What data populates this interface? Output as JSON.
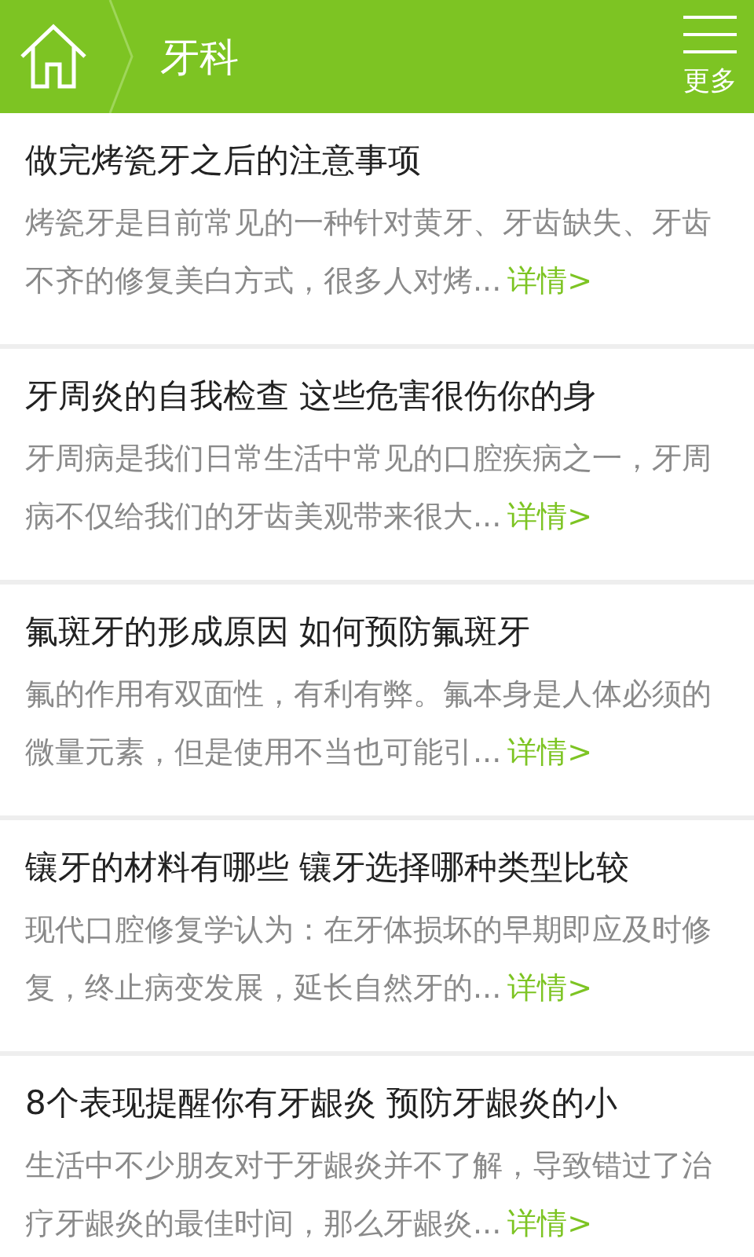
{
  "header": {
    "title": "牙科",
    "more_label": "更多"
  },
  "articles": [
    {
      "title": "做完烤瓷牙之后的注意事项",
      "excerpt": "烤瓷牙是目前常见的一种针对黄牙、牙齿缺失、牙齿不齐的修复美白方式，很多人对烤...",
      "link": "详情>"
    },
    {
      "title": "牙周炎的自我检查 这些危害很伤你的身",
      "excerpt": "牙周病是我们日常生活中常见的口腔疾病之一，牙周病不仅给我们的牙齿美观带来很大...",
      "link": "详情>"
    },
    {
      "title": "氟斑牙的形成原因 如何预防氟斑牙",
      "excerpt": "氟的作用有双面性，有利有弊。氟本身是人体必须的微量元素，但是使用不当也可能引...",
      "link": "详情>"
    },
    {
      "title": "镶牙的材料有哪些 镶牙选择哪种类型比较",
      "excerpt": "现代口腔修复学认为：在牙体损坏的早期即应及时修复，终止病变发展，延长自然牙的...",
      "link": "详情>"
    },
    {
      "title": "8个表现提醒你有牙龈炎 预防牙龈炎的小",
      "excerpt": "生活中不少朋友对于牙龈炎并不了解，导致错过了治疗牙龈炎的最佳时间，那么牙龈炎...",
      "link": "详情>"
    }
  ]
}
